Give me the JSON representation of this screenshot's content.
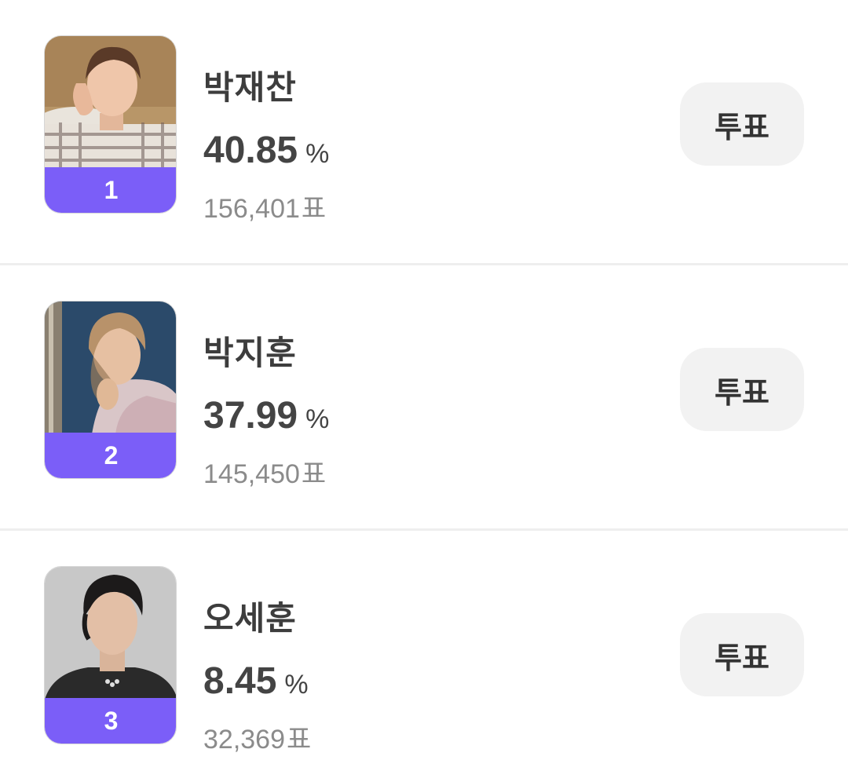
{
  "vote_button_label": "투표",
  "candidates": [
    {
      "rank": "1",
      "name": "박재찬",
      "percent": "40.85",
      "percent_sign": "%",
      "votes": "156,401",
      "votes_unit": "표"
    },
    {
      "rank": "2",
      "name": "박지훈",
      "percent": "37.99",
      "percent_sign": "%",
      "votes": "145,450",
      "votes_unit": "표"
    },
    {
      "rank": "3",
      "name": "오세훈",
      "percent": "8.45",
      "percent_sign": "%",
      "votes": "32,369",
      "votes_unit": "표"
    }
  ],
  "colors": {
    "rank_badge": "#7b5ef8",
    "button_bg": "#f2f2f2",
    "divider": "#eeeeee",
    "vote_count": "#8b8b8b"
  }
}
